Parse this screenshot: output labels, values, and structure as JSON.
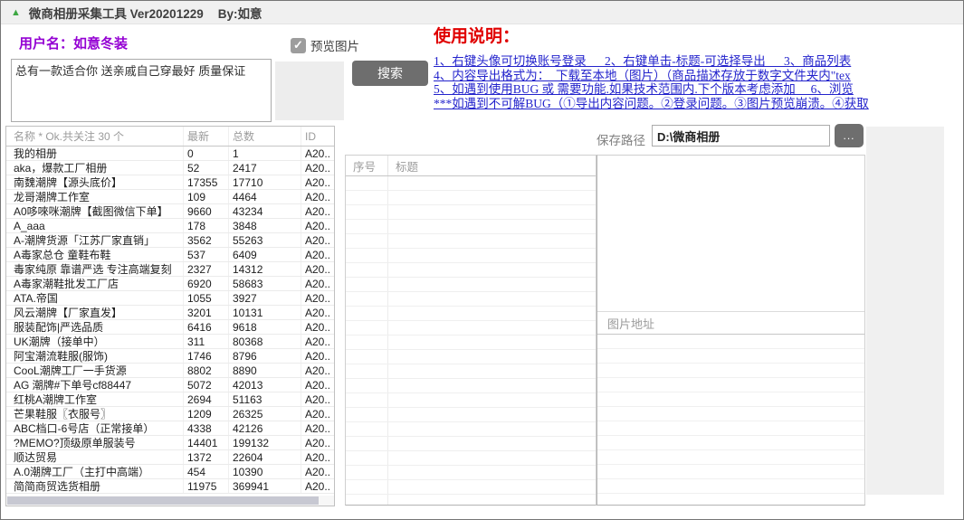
{
  "colors": {
    "accent_purple": "#9400d3",
    "instruction_red": "#e00000",
    "instruction_blue": "#2323cc",
    "button_gray": "#6e6e6e",
    "title_triangle_green": "#3da742",
    "panel_gray": "#f0f0f0"
  },
  "window": {
    "title": "微商相册采集工具 Ver20201229",
    "byline": "By:如意"
  },
  "icons": {
    "app_triangle": "▲",
    "checkbox_check": "✓",
    "browse_ellipsis": "..."
  },
  "user": {
    "label": "用户名：如意冬装"
  },
  "preview": {
    "label": "预览图片",
    "checked": true
  },
  "description": {
    "value": "总有一款适合你 送亲戚自己穿最好 质量保证"
  },
  "search": {
    "label": "搜索"
  },
  "instructions": {
    "title": "使用说明：",
    "lines": [
      "1、右键头像可切换账号登录      2、右键单击-标题-可选择导出      3、商品列表",
      "4、内容导出格式为：  下载至本地（图片）（商品描述存放于数字文件夹内\"tex",
      "5、如遇到使用BUG 或 需要功能.如果技术范围内.下个版本考虑添加     6、浏览",
      "***如遇到不可解BUG（①导出内容问题。②登录问题。③图片预览崩溃。④获取"
    ]
  },
  "save_path": {
    "label": "保存路径",
    "value": "D:\\微商相册",
    "browse": "..."
  },
  "album_table": {
    "columns": [
      "名称 * Ok.共关注 30 个",
      "最新",
      "总数",
      "ID"
    ],
    "rows": [
      [
        "我的相册",
        "0",
        "1",
        "A20.."
      ],
      [
        "aka，爆款工厂相册",
        "52",
        "2417",
        "A20.."
      ],
      [
        "南魏潮牌【源头底价】",
        "17355",
        "17710",
        "A20.."
      ],
      [
        "龙哥潮牌工作室",
        "109",
        "4464",
        "A20.."
      ],
      [
        "A0哆唻咪潮牌【截图微信下单】",
        "9660",
        "43234",
        "A20.."
      ],
      [
        "A_aaa",
        "178",
        "3848",
        "A20.."
      ],
      [
        "A-潮牌货源「江苏厂家直销」",
        "3562",
        "55263",
        "A20.."
      ],
      [
        "A毒家总仓 童鞋布鞋",
        "537",
        "6409",
        "A20.."
      ],
      [
        "毒家纯原 靠谱严选 专注高端复刻",
        "2327",
        "14312",
        "A20.."
      ],
      [
        "A毒家潮鞋批发工厂店",
        "6920",
        "58683",
        "A20.."
      ],
      [
        "ATA.帝国",
        "1055",
        "3927",
        "A20.."
      ],
      [
        "风云潮牌【厂家直发】",
        "3201",
        "10131",
        "A20.."
      ],
      [
        "服装配饰|严选品质",
        "6416",
        "9618",
        "A20.."
      ],
      [
        "UK潮牌（接单中）",
        "311",
        "80368",
        "A20.."
      ],
      [
        "阿宝潮流鞋服(服饰)",
        "1746",
        "8796",
        "A20.."
      ],
      [
        "CooL潮牌工厂一手货源",
        "8802",
        "8890",
        "A20.."
      ],
      [
        "AG 潮牌#下单号cf88447",
        "5072",
        "42013",
        "A20.."
      ],
      [
        "红桃A潮牌工作室",
        "2694",
        "51163",
        "A20.."
      ],
      [
        "芒果鞋服〖衣服号〗",
        "1209",
        "26325",
        "A20.."
      ],
      [
        "ABC档口-6号店（正常接单）",
        "4338",
        "42126",
        "A20.."
      ],
      [
        "?MEMO?顶级原单服装号",
        "14401",
        "199132",
        "A20.."
      ],
      [
        "顺达贸易",
        "1372",
        "22604",
        "A20.."
      ],
      [
        "A.0潮牌工厂（主打中高端）",
        "454",
        "10390",
        "A20.."
      ],
      [
        "简简商贸选货相册",
        "11975",
        "369941",
        "A20.."
      ]
    ]
  },
  "item_table": {
    "columns": [
      "序号",
      "标题"
    ]
  },
  "image_list": {
    "header": "图片地址"
  }
}
